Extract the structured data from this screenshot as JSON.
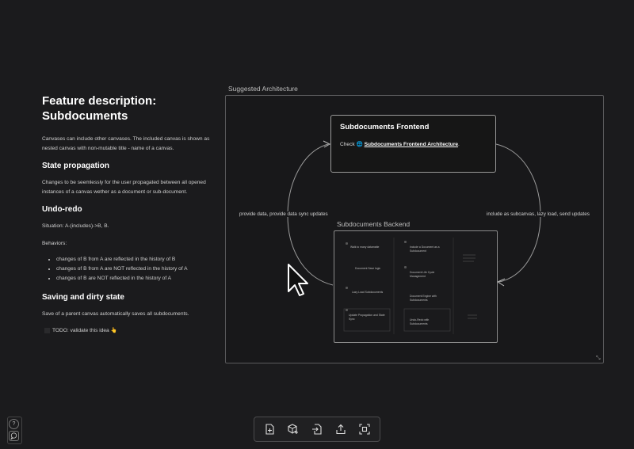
{
  "document": {
    "title": "Feature description: Subdocuments",
    "intro": "Canvases can include other canvases. The included canvas is shown as nested canvas with non-mutable title - name of a canvas.",
    "state_heading": "State propagation",
    "state_text": "Changes to be seemlessly for the user propagated between all opened instances of a canvas wether as a document or sub-document.",
    "undo_heading": "Undo-redo",
    "situation": "Situation: A-(includes)->B, B.",
    "behaviors_label": "Behaviors:",
    "behaviors": [
      "changes of B from A are reflected in the history of B",
      "changes of B from A are NOT reflected in the history of A",
      "changes of B are NOT reflected in the history of A"
    ],
    "saving_heading": "Saving and dirty state",
    "saving_text": "Save of a parent canvas automatically saves all subdocuments.",
    "todo": "TODO: validate this idea 👆"
  },
  "architecture": {
    "label": "Suggested Architecture",
    "frontend_title": "Subdocuments Frontend",
    "check_prefix": "Check ",
    "check_link": "Subdocuments Frontend Architecture",
    "check_suffix": ".",
    "backend_label": "Subdocuments Backend",
    "left_edge": "provide data, provide data sync updates",
    "right_edge": "include as subcanvas, lazy load, send updates",
    "backend_items": [
      "Walk to many datamatte",
      "Include a Document as a Subdocument",
      "Document Save logic",
      "Document Life Cycle Management",
      "Lazy Load Subdocuments",
      "Document Engine with Subdocuments",
      "Update Propagation and State Sync",
      "Undo-Redo with Subdocuments"
    ]
  },
  "toolbar": {
    "buttons": [
      "new-document-icon",
      "add-component-icon",
      "import-icon",
      "share-icon",
      "fit-to-screen-icon"
    ]
  },
  "sidebar": {
    "help_icon": "?",
    "chat_icon": "💬"
  }
}
